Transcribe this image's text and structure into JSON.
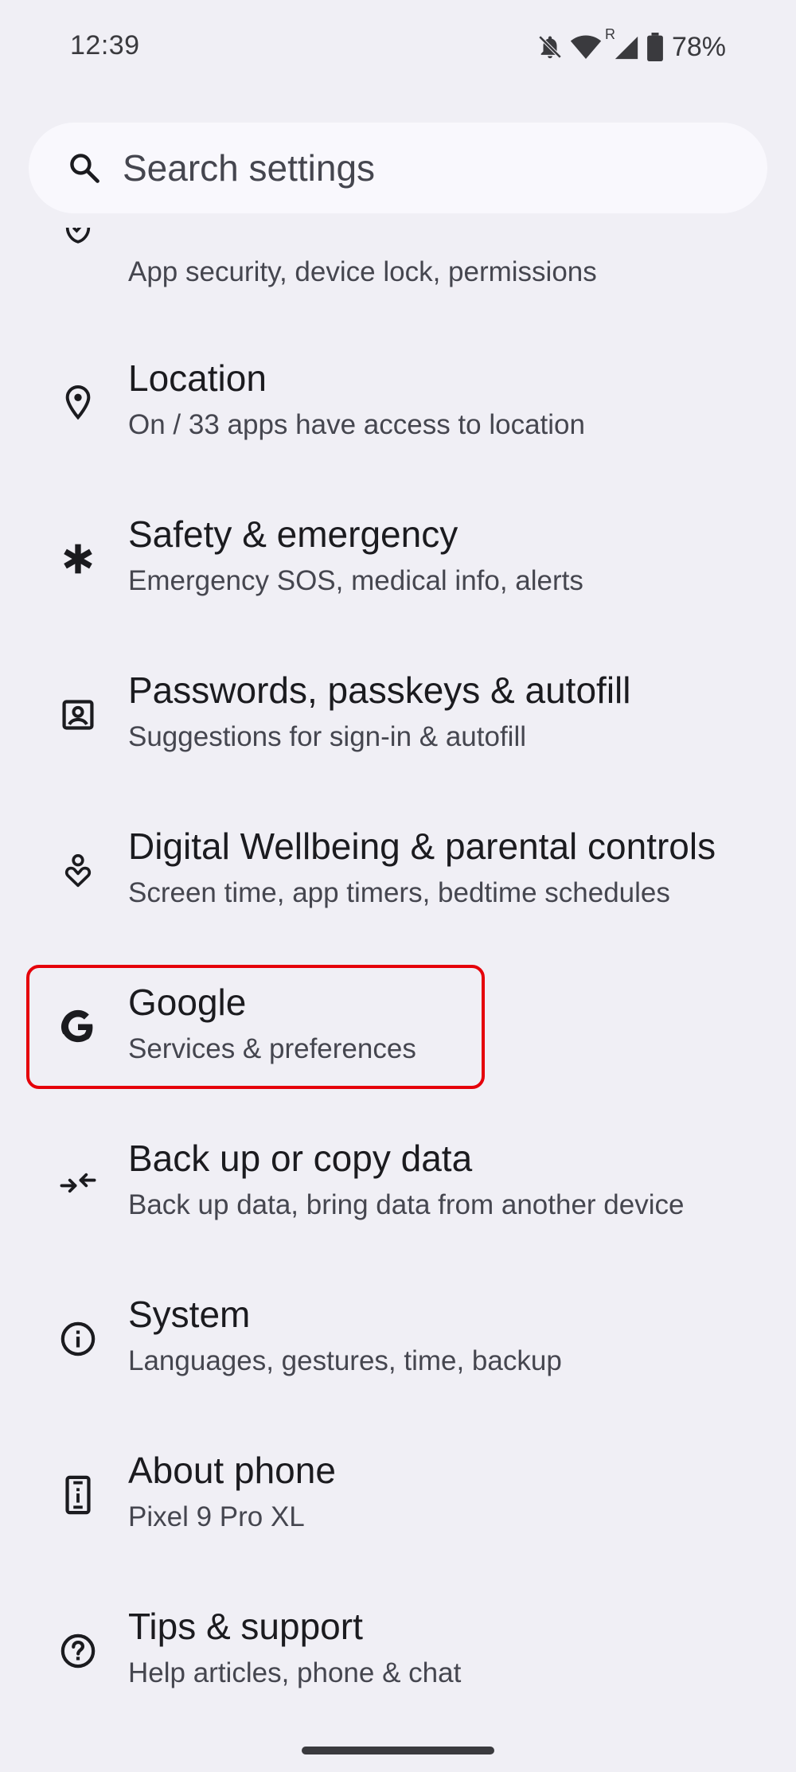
{
  "status_bar": {
    "time": "12:39",
    "icons": [
      "mute-icon",
      "wifi-icon",
      "signal-roaming-icon",
      "battery-icon"
    ],
    "roaming_label": "R",
    "battery_percent": "78%"
  },
  "search": {
    "placeholder": "Search settings"
  },
  "settings": {
    "items": [
      {
        "icon": "security-privacy-icon",
        "title": "",
        "subtitle": "App security, device lock, permissions"
      },
      {
        "icon": "location-pin-icon",
        "title": "Location",
        "subtitle": "On / 33 apps have access to location"
      },
      {
        "icon": "asterisk-icon",
        "title": "Safety & emergency",
        "subtitle": "Emergency SOS, medical info, alerts"
      },
      {
        "icon": "account-box-icon",
        "title": "Passwords, passkeys & autofill",
        "subtitle": "Suggestions for sign-in & autofill"
      },
      {
        "icon": "wellbeing-icon",
        "title": "Digital Wellbeing & parental controls",
        "subtitle": "Screen time, app timers, bedtime schedules"
      },
      {
        "icon": "google-g-icon",
        "title": "Google",
        "subtitle": "Services & preferences"
      },
      {
        "icon": "backup-arrows-icon",
        "title": "Back up or copy data",
        "subtitle": "Back up data, bring data from another device"
      },
      {
        "icon": "info-icon",
        "title": "System",
        "subtitle": "Languages, gestures, time, backup"
      },
      {
        "icon": "phone-info-icon",
        "title": "About phone",
        "subtitle": "Pixel 9 Pro XL"
      },
      {
        "icon": "help-icon",
        "title": "Tips & support",
        "subtitle": "Help articles, phone & chat"
      }
    ]
  },
  "colors": {
    "background": "#f0eff5",
    "search_bar": "#f9f8fd",
    "highlight": "#e5000a",
    "title_text": "#1b1b1f",
    "subtitle_text": "#45464f"
  }
}
